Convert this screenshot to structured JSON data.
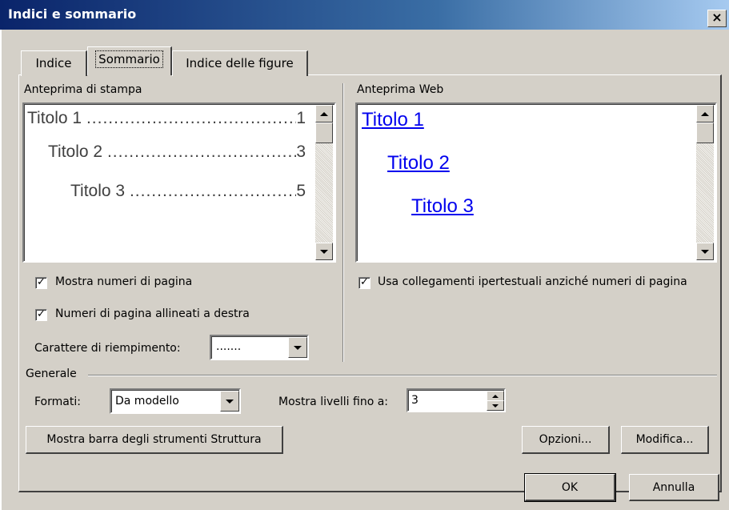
{
  "window": {
    "title": "Indici e sommario",
    "close_glyph": "×"
  },
  "tabs": [
    {
      "label": "Indice",
      "active": false
    },
    {
      "label": "Sommario",
      "active": true
    },
    {
      "label": "Indice delle figure",
      "active": false
    }
  ],
  "print_preview": {
    "label": "Anteprima di stampa",
    "entries": [
      {
        "title": "Titolo 1",
        "page": "1"
      },
      {
        "title": "Titolo 2",
        "page": "3"
      },
      {
        "title": "Titolo 3",
        "page": "5"
      }
    ],
    "leader": "..............................................................."
  },
  "web_preview": {
    "label": "Anteprima Web",
    "links": [
      "Titolo 1",
      "Titolo 2",
      "Titolo 3"
    ]
  },
  "options": {
    "show_page_numbers": {
      "label": "Mostra numeri di pagina",
      "checked": true,
      "mark": "✓"
    },
    "right_align": {
      "label": "Numeri di pagina allineati a destra",
      "checked": true,
      "mark": "✓"
    },
    "use_hyperlinks": {
      "label": "Usa collegamenti ipertestuali anziché numeri di pagina",
      "checked": true,
      "mark": "✓"
    },
    "tab_leader": {
      "label": "Carattere di riempimento:",
      "value": "......."
    }
  },
  "general": {
    "label": "Generale",
    "formats_label": "Formati:",
    "formats_value": "Da modello",
    "levels_label": "Mostra livelli fino a:",
    "levels_value": "3"
  },
  "buttons": {
    "outline_toolbar": "Mostra barra degli strumenti Struttura",
    "options": "Opzioni...",
    "modify": "Modifica...",
    "ok": "OK",
    "cancel": "Annulla"
  },
  "colors": {
    "dialog_bg": "#d4d0c8",
    "title_gradient_start": "#0a246a",
    "title_gradient_end": "#a6caf0",
    "hyperlink": "#0000ee"
  }
}
